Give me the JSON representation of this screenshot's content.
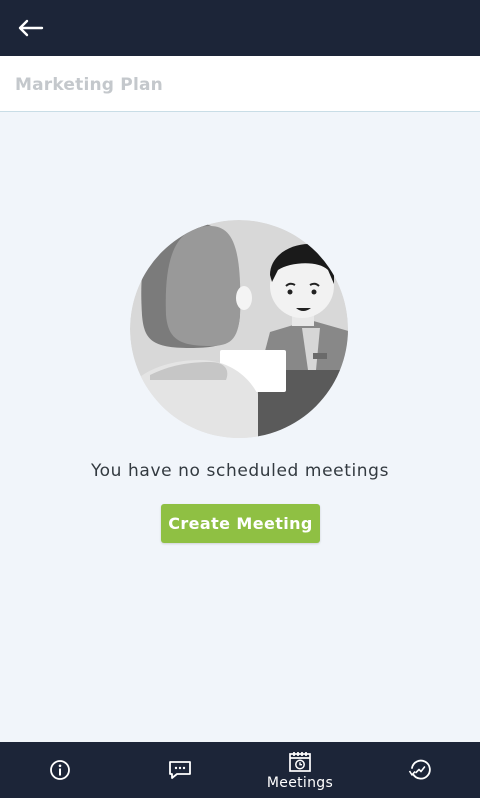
{
  "header": {
    "back_icon": "arrow-left-icon",
    "title": "Marketing Plan"
  },
  "colors": {
    "topbar": "#1c2538",
    "accent_button": "#8fc043",
    "background": "#f1f5fa"
  },
  "empty_state": {
    "message": "You have no scheduled meetings",
    "button_label": "Create Meeting",
    "illustration": "meeting-illustration"
  },
  "bottom_nav": {
    "items": [
      {
        "icon": "info-icon",
        "label": ""
      },
      {
        "icon": "chat-icon",
        "label": ""
      },
      {
        "icon": "meetings-icon",
        "label": "Meetings",
        "active": true
      },
      {
        "icon": "activity-icon",
        "label": ""
      }
    ]
  }
}
